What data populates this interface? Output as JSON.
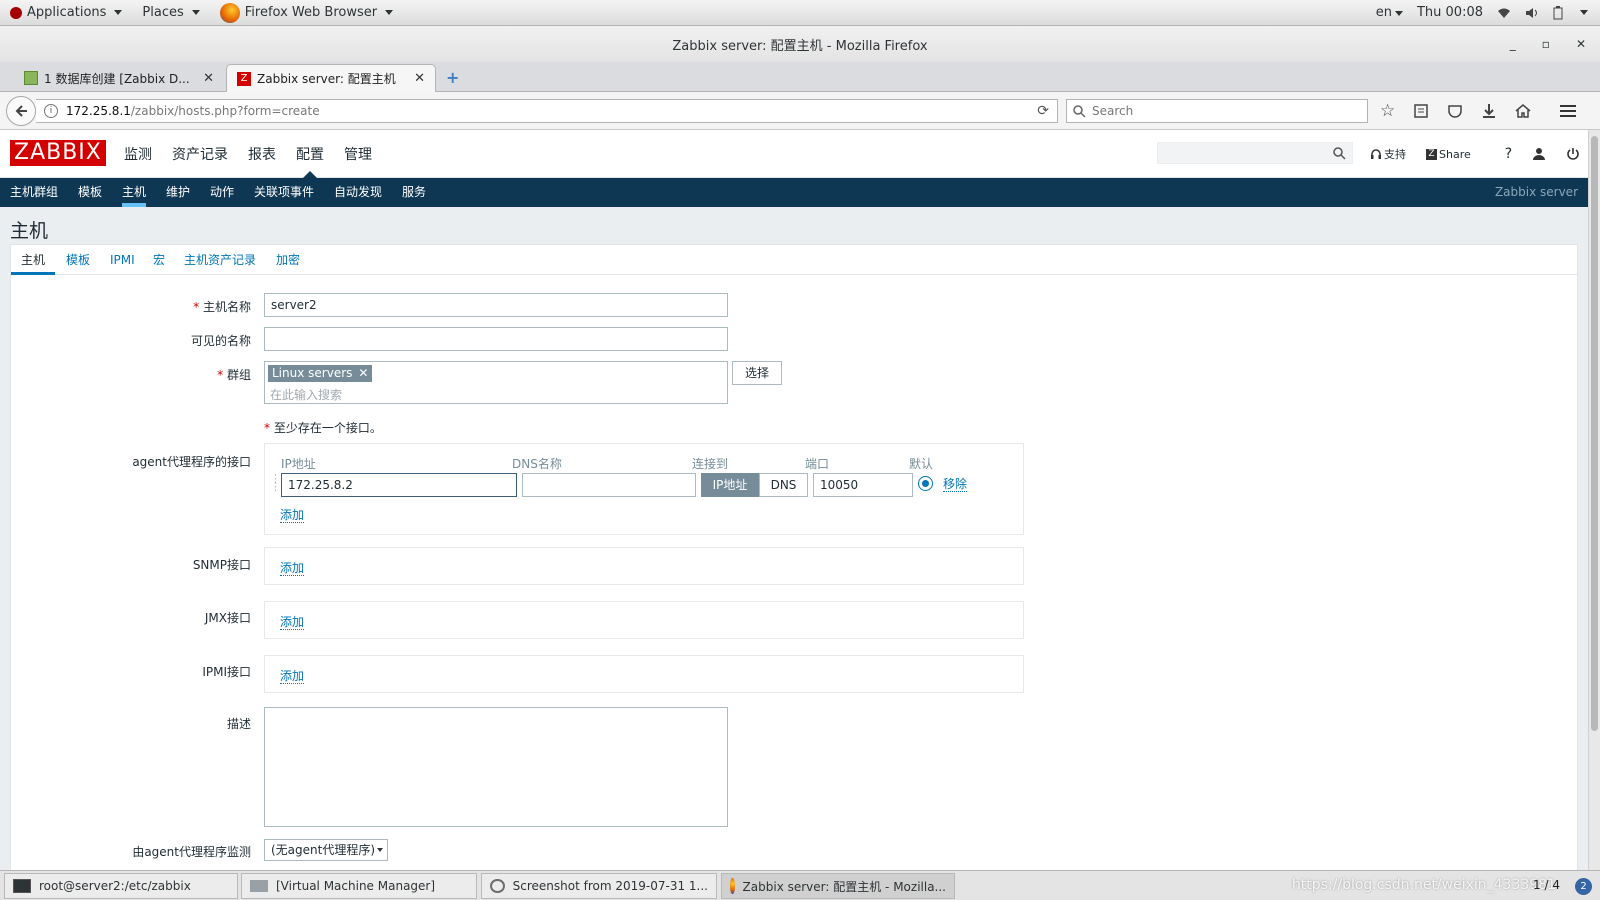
{
  "gnome": {
    "applications": "Applications",
    "places": "Places",
    "app_name": "Firefox Web Browser",
    "lang": "en",
    "clock": "Thu 00:08"
  },
  "window": {
    "title": "Zabbix server: 配置主机 - Mozilla Firefox"
  },
  "tabs": [
    {
      "label": "1 数据库创建 [Zabbix D..."
    },
    {
      "label": "Zabbix server: 配置主机"
    }
  ],
  "url": {
    "host": "172.25.8.1",
    "path": "/zabbix/hosts.php?form=create",
    "search_placeholder": "Search"
  },
  "zabbix": {
    "logo": "ZABBIX",
    "main_menu": [
      "监测",
      "资产记录",
      "报表",
      "配置",
      "管理"
    ],
    "support": "支持",
    "share": "Share",
    "help": "?",
    "sub_menu": [
      "主机群组",
      "模板",
      "主机",
      "维护",
      "动作",
      "关联项事件",
      "自动发现",
      "服务"
    ],
    "server_name": "Zabbix server",
    "page_title": "主机",
    "form_tabs": [
      "主机",
      "模板",
      "IPMI",
      "宏",
      "主机资产记录",
      "加密"
    ]
  },
  "form": {
    "host_name_label": "主机名称",
    "host_name_value": "server2",
    "visible_name_label": "可见的名称",
    "visible_name_value": "",
    "groups_label": "群组",
    "group_tag": "Linux servers",
    "groups_placeholder": "在此输入搜索",
    "select_button": "选择",
    "interface_note": "至少存在一个接口。",
    "agent_label": "agent代理程序的接口",
    "col_ip": "IP地址",
    "col_dns": "DNS名称",
    "col_connect": "连接到",
    "col_port": "端口",
    "col_default": "默认",
    "ip_value": "172.25.8.2",
    "dns_value": "",
    "connect_ip": "IP地址",
    "connect_dns": "DNS",
    "port_value": "10050",
    "remove_link": "移除",
    "add_link": "添加",
    "snmp_label": "SNMP接口",
    "jmx_label": "JMX接口",
    "ipmi_label": "IPMI接口",
    "description_label": "描述",
    "proxy_label": "由agent代理程序监测",
    "proxy_value": "(无agent代理程序)"
  },
  "taskbar": {
    "items": [
      "root@server2:/etc/zabbix",
      "[Virtual Machine Manager]",
      "Screenshot from 2019-07-31 1...",
      "Zabbix server: 配置主机 - Mozilla..."
    ],
    "workspace": "1 / 4",
    "watermark": "https://blog.csdn.net/weixin_4333981"
  },
  "colors": {
    "zabbix_red": "#d40000",
    "nav_blue": "#0e3753",
    "link_blue": "#0275b8",
    "active_tab_blue": "#65c0f3"
  }
}
